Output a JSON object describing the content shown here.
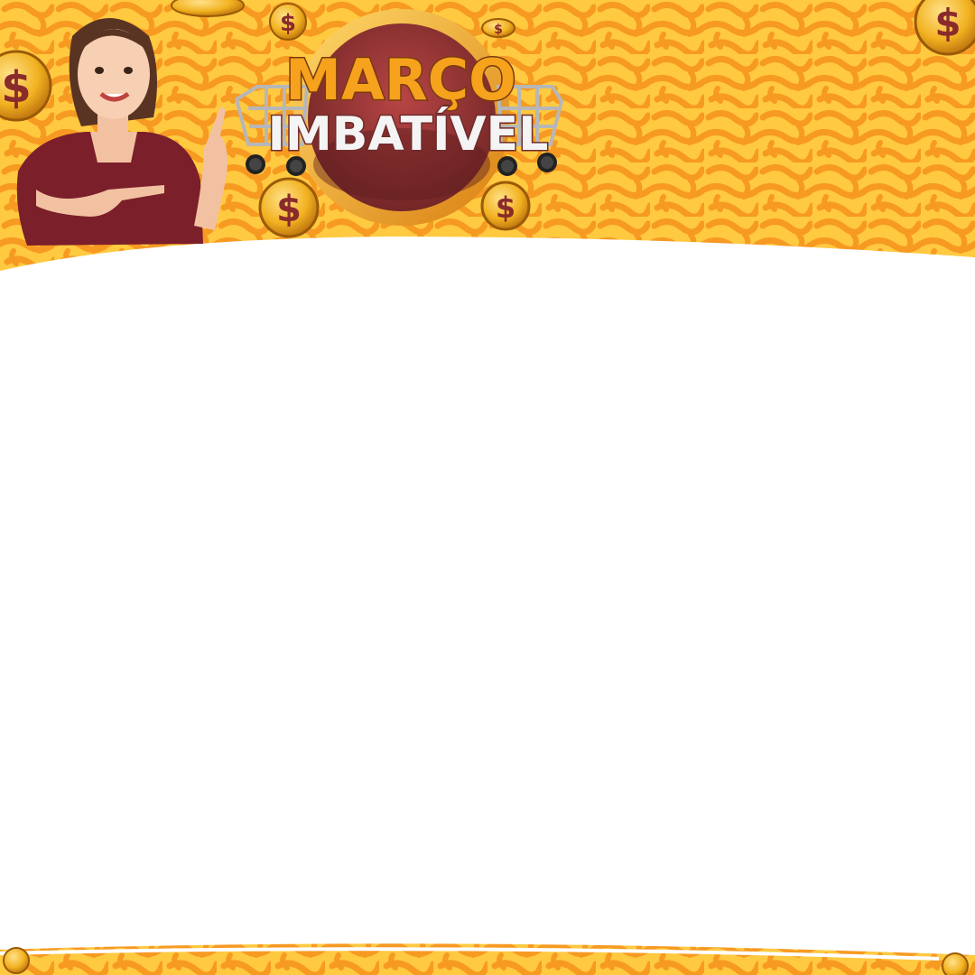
{
  "banner": {
    "logo_line1": "MARÇO",
    "logo_line2": "IMBATÍVEL",
    "currency_symbol": "$"
  },
  "icons": {
    "coin": "dollar-coin-icon",
    "cart": "shopping-cart-icon"
  },
  "colors": {
    "background": "#ffffff",
    "pattern_light": "#ffd45a",
    "pattern_dark": "#f7a52a",
    "brand_wine": "#8a2b2b",
    "logo_gold": "#f6a21c",
    "logo_silver": "#f4f4f4",
    "coin_gold": "#f2b221"
  }
}
